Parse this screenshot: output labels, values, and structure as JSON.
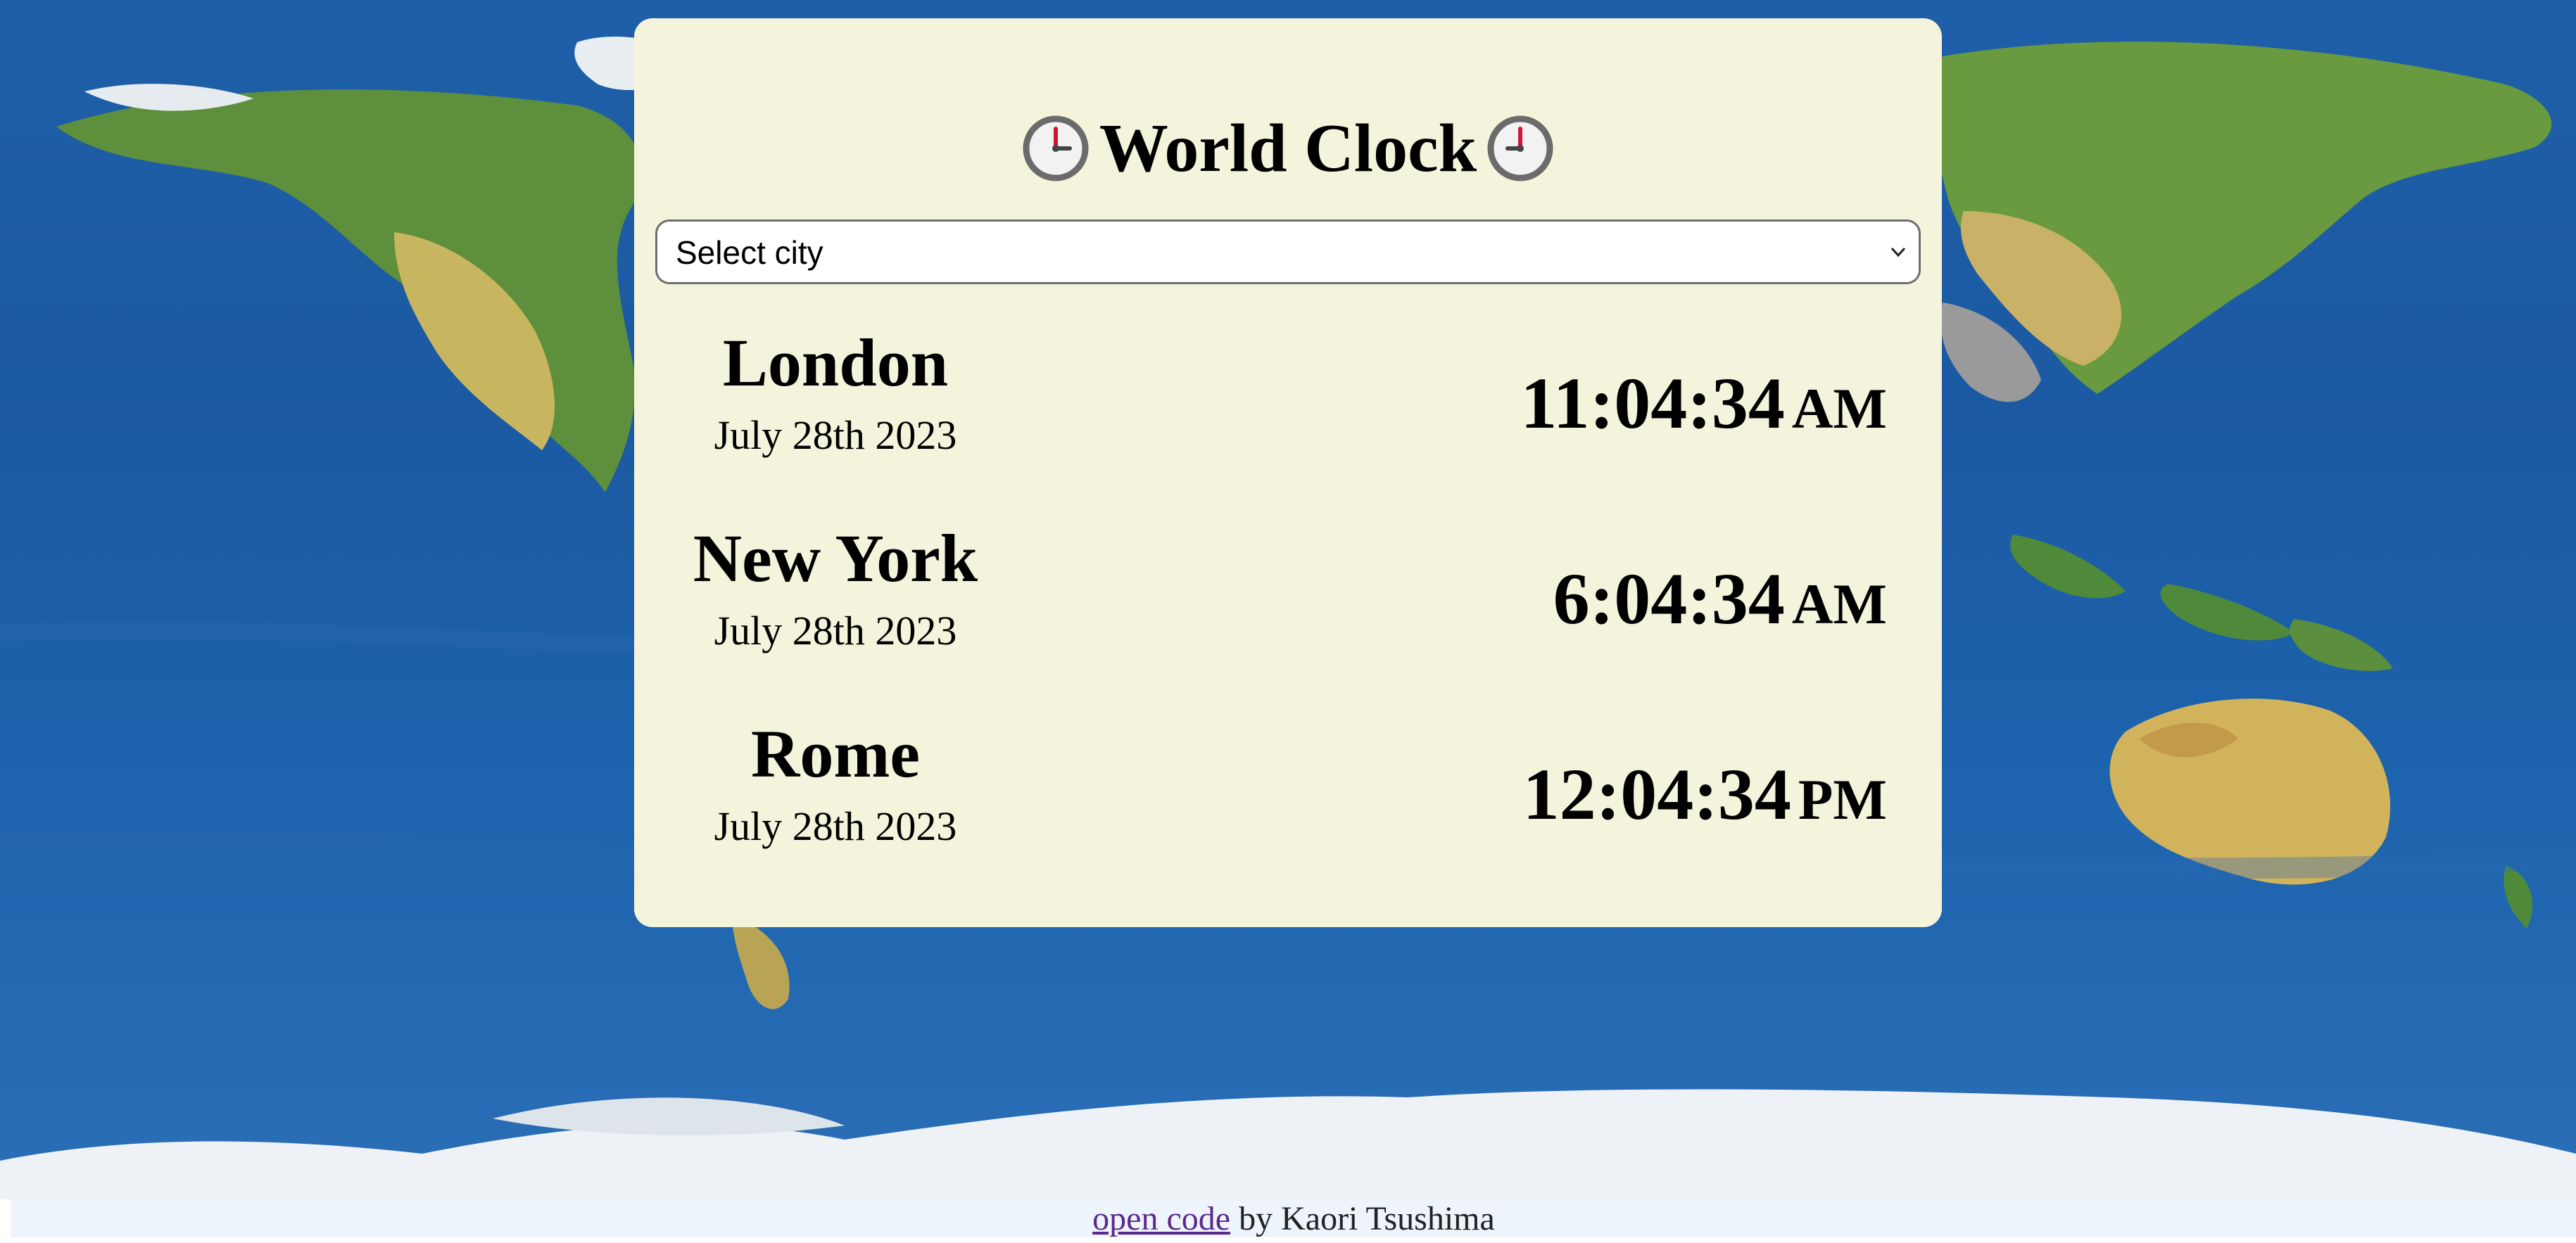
{
  "app": {
    "title": "World Clock",
    "title_icon": "clock-icon"
  },
  "city_select": {
    "selected": "Select city",
    "icon": "chevron-down-icon"
  },
  "cities": [
    {
      "name": "London",
      "date": "July 28th 2023",
      "time": "11:04:34",
      "period": "AM"
    },
    {
      "name": "New York",
      "date": "July 28th 2023",
      "time": "6:04:34",
      "period": "AM"
    },
    {
      "name": "Rome",
      "date": "July 28th 2023",
      "time": "12:04:34",
      "period": "PM"
    }
  ],
  "footer": {
    "link_text": "open code",
    "suffix": "by Kaori Tsushima"
  },
  "colors": {
    "card_background": "#f4f3dc",
    "ocean": "#1d5ea8",
    "link": "#5a2a8c",
    "footer_background": "#eef4fb"
  }
}
